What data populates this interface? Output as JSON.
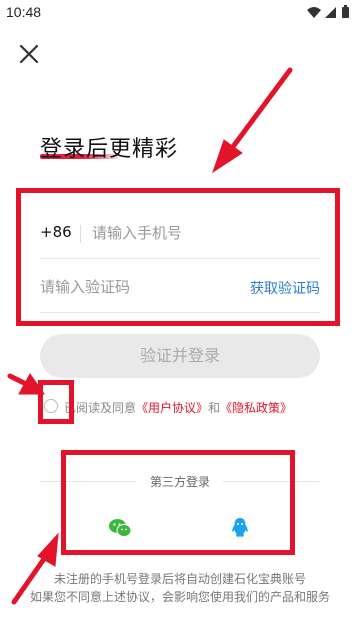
{
  "status_bar": {
    "time": "10:48"
  },
  "heading": "登录后更精彩",
  "form": {
    "country_code": "+86",
    "phone_placeholder": "请输入手机号",
    "code_placeholder": "请输入验证码",
    "get_code_label": "获取验证码",
    "login_label": "验证并登录"
  },
  "agreement": {
    "prefix": "已阅读及同意",
    "user_agreement": "《用户协议》",
    "and": "和",
    "privacy_policy": "《隐私政策》"
  },
  "third_party": {
    "title": "第三方登录",
    "providers": [
      "wechat-icon",
      "qq-icon"
    ]
  },
  "bottom_note": {
    "line1": "未注册的手机号登录后将自动创建石化宝典账号",
    "line2": "如果您不同意上述协议，会影响您使用我们的产品和服务"
  },
  "colors": {
    "annotation_red": "#e3142a",
    "link_blue": "#2b7bd9",
    "wechat_green": "#3bb83b",
    "qq_blue": "#1aa1f0"
  }
}
